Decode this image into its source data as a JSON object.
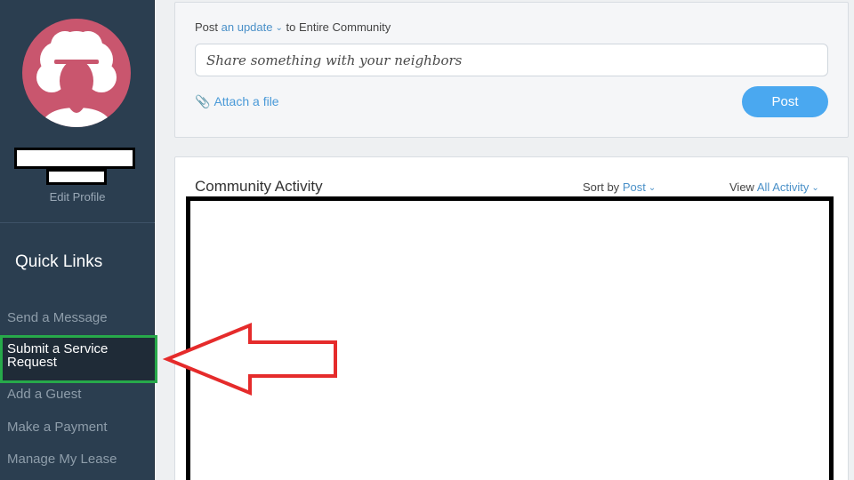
{
  "sidebar": {
    "edit_profile": "Edit Profile",
    "quick_links_title": "Quick Links",
    "items": [
      {
        "label": "Send a Message"
      },
      {
        "label": "Submit a Service Request"
      },
      {
        "label": "Add a Guest"
      },
      {
        "label": "Make a Payment"
      },
      {
        "label": "Manage My Lease"
      }
    ]
  },
  "composer": {
    "prefix": "Post",
    "type_link": "an update",
    "audience": "to Entire Community",
    "placeholder": "Share something with your neighbors",
    "attach_label": "Attach a file",
    "post_button": "Post"
  },
  "activity": {
    "title": "Community Activity",
    "sort_label": "Sort by",
    "sort_value": "Post",
    "view_label": "View",
    "view_value": "All Activity"
  },
  "colors": {
    "sidebar_bg": "#2b3e50",
    "avatar_bg": "#c9566e",
    "accent": "#4aa8f0",
    "highlight_border": "#27a94a",
    "arrow": "#e52b2b"
  }
}
